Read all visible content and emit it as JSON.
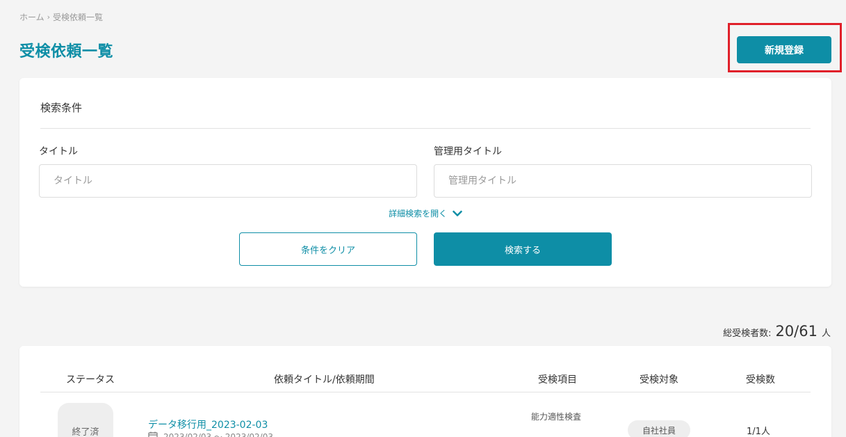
{
  "breadcrumb": {
    "home": "ホーム",
    "separator": "›",
    "current": "受検依頼一覧"
  },
  "page_title": "受検依頼一覧",
  "new_button_label": "新規登録",
  "search": {
    "heading": "検索条件",
    "title_label": "タイトル",
    "title_placeholder": "タイトル",
    "admin_title_label": "管理用タイトル",
    "admin_title_placeholder": "管理用タイトル",
    "advanced_link": "詳細検索を開く",
    "clear_label": "条件をクリア",
    "search_label": "検索する"
  },
  "summary": {
    "label": "総受検者数:",
    "value": "20/61",
    "unit": "人"
  },
  "table": {
    "headers": [
      "ステータス",
      "依頼タイトル/依頼期間",
      "受検項目",
      "受検対象",
      "受検数"
    ],
    "rows": [
      {
        "status": "終了済",
        "title": "データ移行用_2023-02-03",
        "period": "2023/02/03 ～ 2023/02/03",
        "exam": "能力適性検査",
        "target": "自社社員",
        "count": "1/1人"
      }
    ]
  },
  "colors": {
    "accent": "#0e8ea6",
    "highlight": "#e0202a"
  }
}
